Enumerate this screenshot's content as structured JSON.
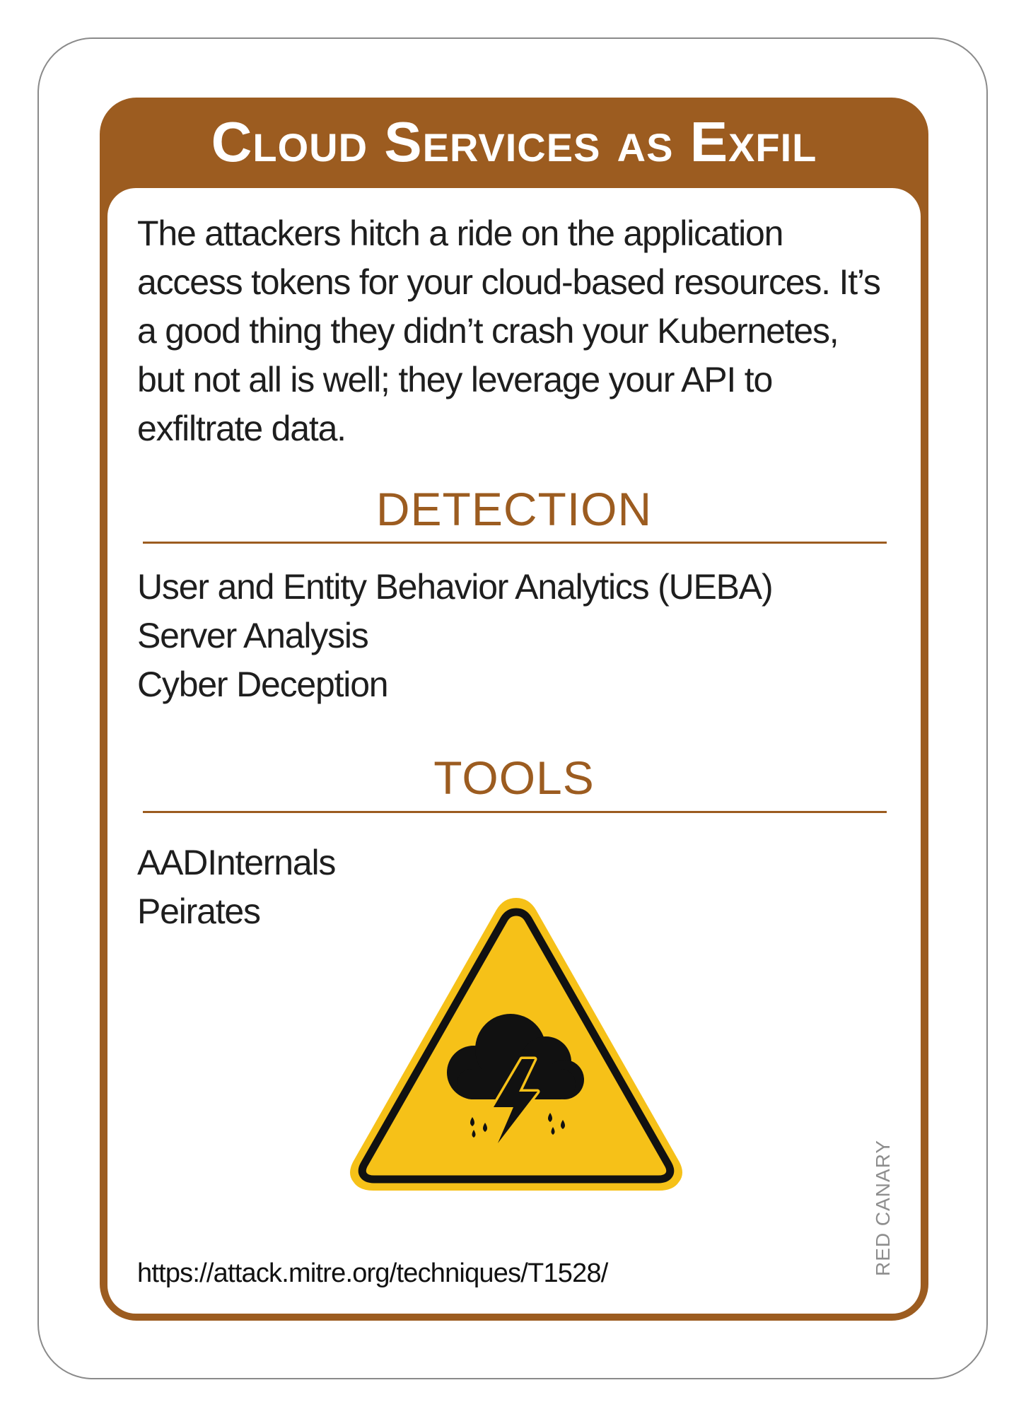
{
  "card": {
    "title": "Cloud Services as Exfil",
    "description": "The attackers hitch a ride on the application access tokens for your cloud-based resources. It’s a good thing they didn’t crash your Kubernetes, but not all is well; they leverage your API to exfiltrate data.",
    "detection": {
      "heading": "DETECTION",
      "items": [
        "User and Entity Behavior Analytics (UEBA)",
        "Server Analysis",
        "Cyber Deception"
      ]
    },
    "tools": {
      "heading": "TOOLS",
      "items": [
        "AADInternals",
        "Peirates"
      ]
    },
    "icon": "storm-warning-icon",
    "url": "https://attack.mitre.org/techniques/T1528/",
    "brand": "RED CANARY"
  },
  "colors": {
    "accent": "#9c5c20",
    "warning_fill": "#f6c118",
    "text": "#1e1e1e",
    "brand_text": "#8e8e8e"
  }
}
